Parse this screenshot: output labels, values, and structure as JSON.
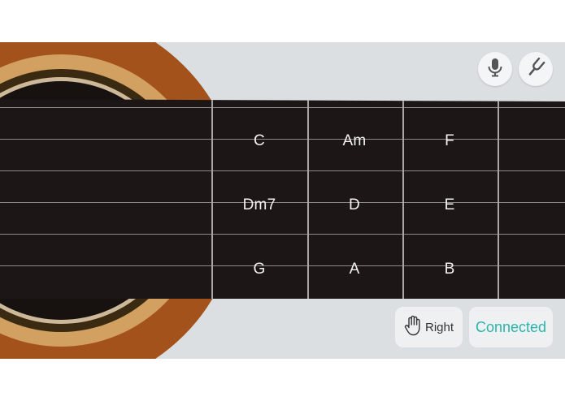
{
  "toolbar": {
    "mic_icon": "microphone-icon",
    "tuner_icon": "tuning-fork-icon"
  },
  "chords": [
    [
      "C",
      "Am",
      "F"
    ],
    [
      "Dm7",
      "D",
      "E"
    ],
    [
      "G",
      "A",
      "B"
    ]
  ],
  "bottom_bar": {
    "hand_icon": "hand-icon",
    "hand_label": "Right",
    "connection_label": "Connected"
  },
  "colors": {
    "guitar_body": "#a3521b",
    "sound_hole_ring": "#d2a060",
    "fretboard": "#1c1616",
    "accent": "#2bb3ad"
  }
}
